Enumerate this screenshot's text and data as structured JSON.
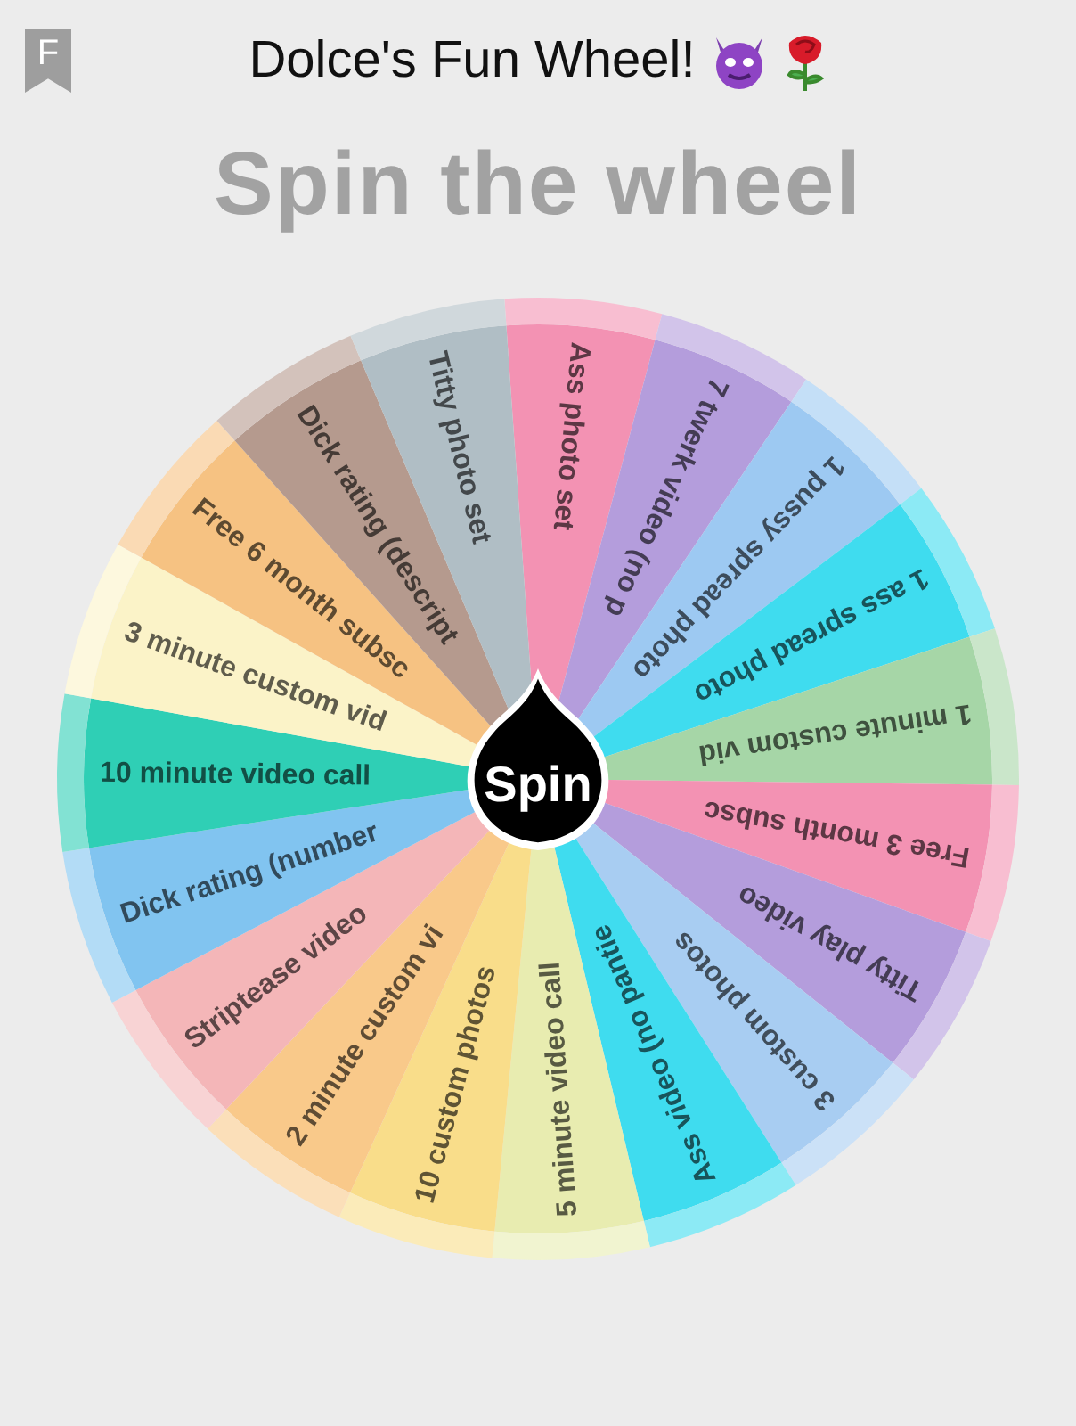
{
  "header": {
    "bookmark_letter": "F",
    "title": "Dolce's Fun Wheel!"
  },
  "heading": "Spin the wheel",
  "wheel": {
    "spin_button": "Spin",
    "segments": [
      {
        "label": "Ass photo set",
        "color": "#f392b3"
      },
      {
        "label": "7 twerk video (no p",
        "color": "#b49ddc"
      },
      {
        "label": "1 pussy spread photo",
        "color": "#9dc9f2"
      },
      {
        "label": "1 ass spread photo",
        "color": "#3fdcef"
      },
      {
        "label": "1 minute custom vid",
        "color": "#a6d6a7"
      },
      {
        "label": "Free 3 month subsc",
        "color": "#f392b3"
      },
      {
        "label": "Titty play video",
        "color": "#b49ddc"
      },
      {
        "label": "3 custom photos",
        "color": "#a8cdf2"
      },
      {
        "label": "Ass video (no pantie",
        "color": "#3fdcef"
      },
      {
        "label": "5 minute video call",
        "color": "#e8ecb0"
      },
      {
        "label": "10 custom photos",
        "color": "#f9dd8a"
      },
      {
        "label": "2 minute custom vi",
        "color": "#f9c98a"
      },
      {
        "label": "Striptease video",
        "color": "#f4b6b8"
      },
      {
        "label": "Dick rating (number",
        "color": "#81c4f0"
      },
      {
        "label": "10 minute video call",
        "color": "#2fcfb5"
      },
      {
        "label": "3 minute custom vid",
        "color": "#fbf3c8"
      },
      {
        "label": "Free 6 month subsc",
        "color": "#f6c282"
      },
      {
        "label": "Dick rating (descript",
        "color": "#b59a8e"
      },
      {
        "label": "Titty photo set",
        "color": "#b0bec5"
      }
    ]
  }
}
